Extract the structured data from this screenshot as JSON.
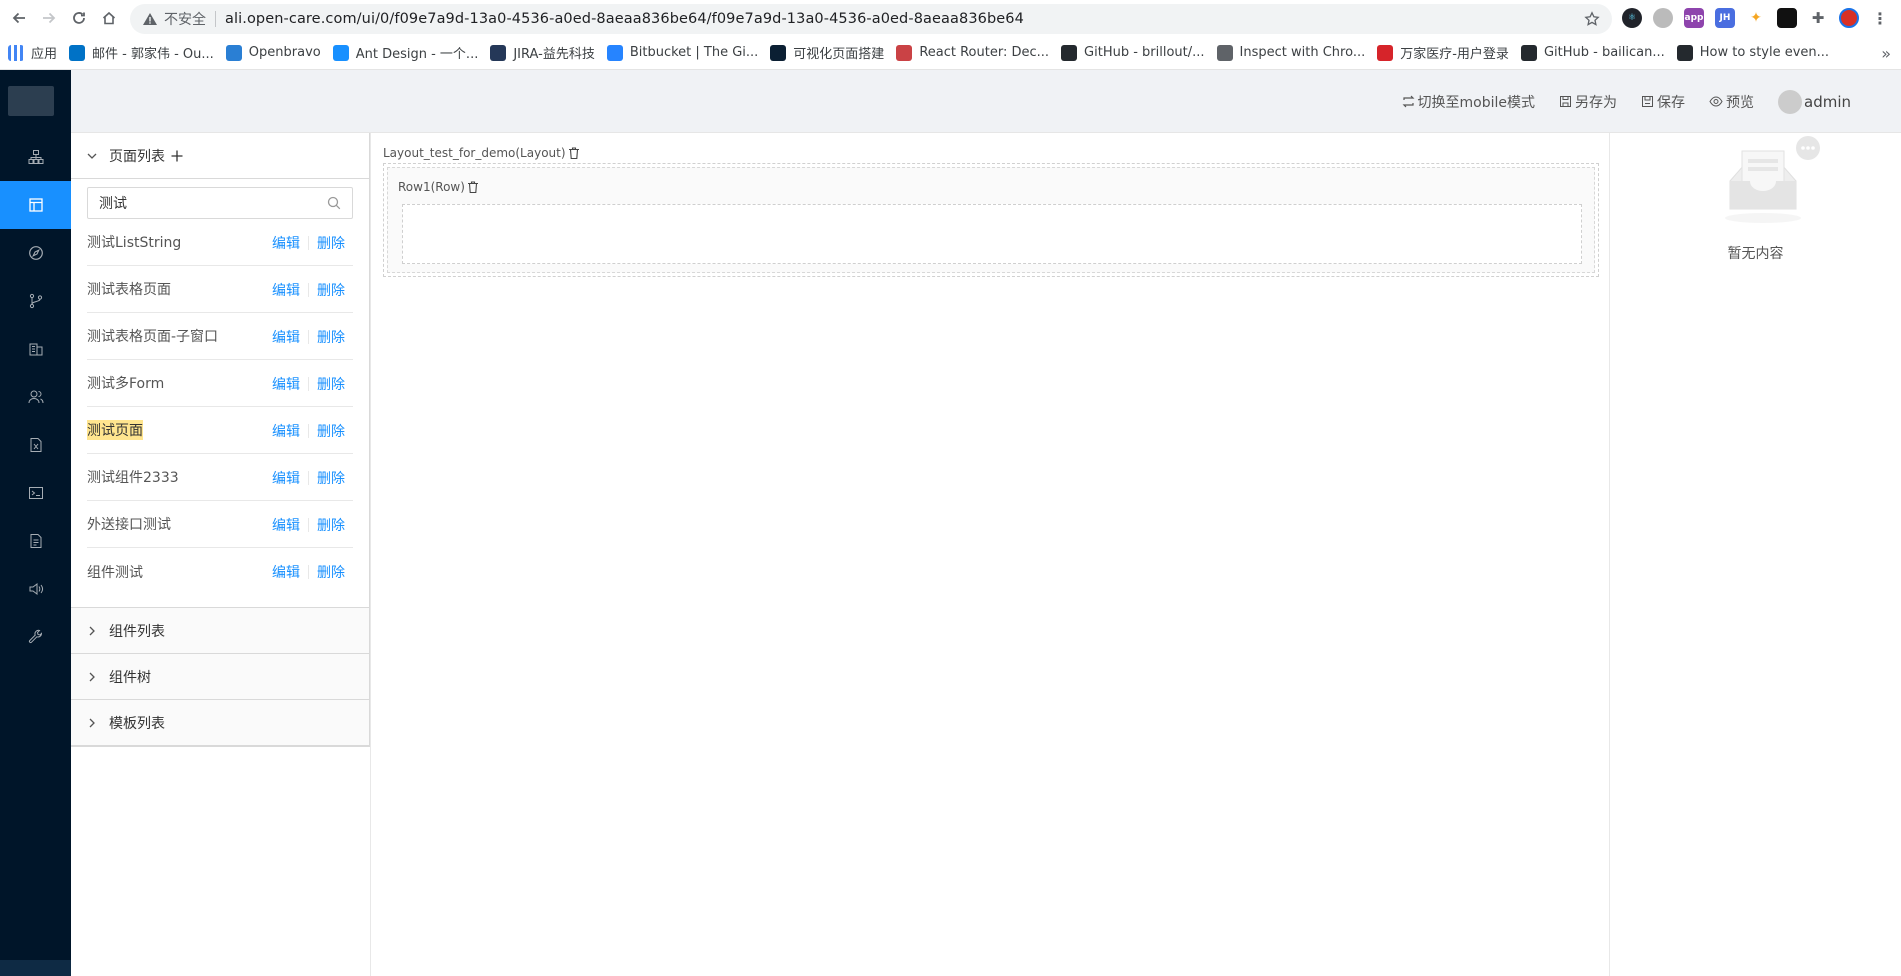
{
  "browser": {
    "insecure_label": "不安全",
    "url": "ali.open-care.com/ui/0/f09e7a9d-13a0-4536-a0ed-8aeaa836be64/f09e7a9d-13a0-4536-a0ed-8aeaa836be64",
    "bookmarks": [
      {
        "label": "应用",
        "icon_color": "#4285f4"
      },
      {
        "label": "邮件 - 郭家伟 - Ou...",
        "icon_color": "#0072c6"
      },
      {
        "label": "Openbravo",
        "icon_color": "#2a7fd4"
      },
      {
        "label": "Ant Design - 一个...",
        "icon_color": "#1890ff"
      },
      {
        "label": "JIRA-益先科技",
        "icon_color": "#253858"
      },
      {
        "label": "Bitbucket | The Gi...",
        "icon_color": "#2684ff"
      },
      {
        "label": "可视化页面搭建",
        "icon_color": "#0b1f33"
      },
      {
        "label": "React Router: Dec...",
        "icon_color": "#ca4245"
      },
      {
        "label": "GitHub - brillout/...",
        "icon_color": "#24292e"
      },
      {
        "label": "Inspect with Chro...",
        "icon_color": "#5f6368"
      },
      {
        "label": "万家医疗-用户登录",
        "icon_color": "#d6242a"
      },
      {
        "label": "GitHub - bailican...",
        "icon_color": "#24292e"
      },
      {
        "label": "How to style even...",
        "icon_color": "#24292e"
      }
    ]
  },
  "header": {
    "switch_mobile": "切换至mobile模式",
    "save_as": "另存为",
    "save": "保存",
    "preview": "预览",
    "user": "admin"
  },
  "left_panel": {
    "page_list_title": "页面列表",
    "search": {
      "value": "测试",
      "placeholder": ""
    },
    "pages": [
      {
        "name": "测试ListString",
        "highlighted": false
      },
      {
        "name": "测试表格页面",
        "highlighted": false
      },
      {
        "name": "测试表格页面-子窗口",
        "highlighted": false
      },
      {
        "name": "测试多Form",
        "highlighted": false
      },
      {
        "name": "测试页面",
        "highlighted": true
      },
      {
        "name": "测试组件2333",
        "highlighted": false
      },
      {
        "name": "外送接口测试",
        "highlighted": false
      },
      {
        "name": "组件测试",
        "highlighted": false
      }
    ],
    "edit_label": "编辑",
    "delete_label": "删除",
    "component_list_title": "组件列表",
    "component_tree_title": "组件树",
    "template_list_title": "模板列表"
  },
  "canvas": {
    "layout_label": "Layout_test_for_demo(Layout)",
    "row_label": "Row1(Row)"
  },
  "right_panel": {
    "empty_text": "暂无内容"
  },
  "colors": {
    "primary": "#1890ff",
    "sidebar": "#001529",
    "highlight": "#ffe58f"
  }
}
